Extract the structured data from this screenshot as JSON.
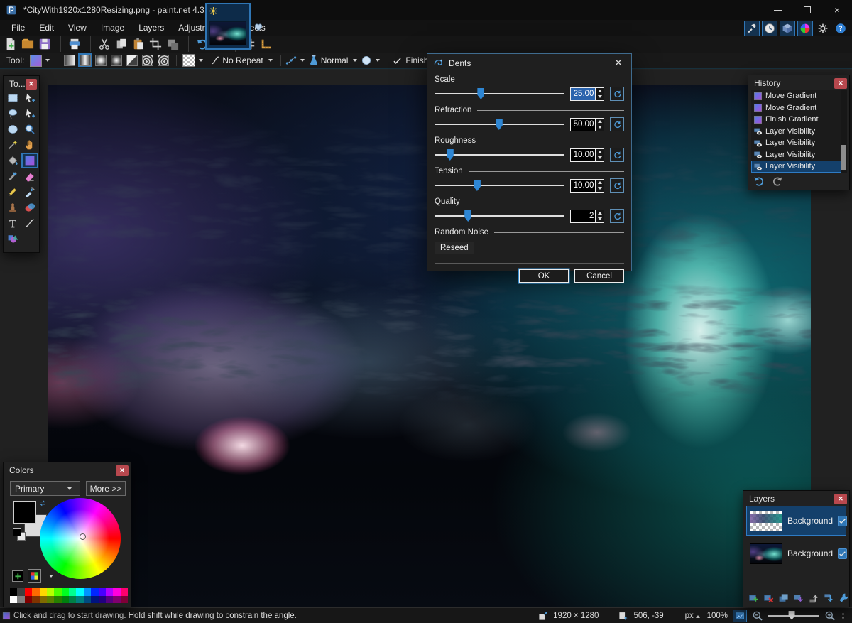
{
  "window": {
    "title": "*CityWith1920x1280Resizing.png - paint.net 4.3.12"
  },
  "menu": {
    "items": [
      "File",
      "Edit",
      "View",
      "Image",
      "Layers",
      "Adjustments",
      "Effects"
    ]
  },
  "toolbar": {
    "buttons": [
      {
        "icon": "new",
        "name": "new-image-button"
      },
      {
        "icon": "open",
        "name": "open-button"
      },
      {
        "icon": "save",
        "name": "save-button"
      },
      {
        "icon": "print",
        "name": "print-button",
        "gap": true
      },
      {
        "icon": "cut",
        "name": "cut-button",
        "gap": true
      },
      {
        "icon": "copy",
        "name": "copy-button"
      },
      {
        "icon": "paste",
        "name": "paste-button"
      },
      {
        "icon": "crop",
        "name": "crop-to-selection-button"
      },
      {
        "icon": "deselect",
        "name": "deselect-button"
      },
      {
        "icon": "undo",
        "name": "undo-button",
        "gap": true
      },
      {
        "icon": "redo",
        "name": "redo-button"
      },
      {
        "icon": "grid",
        "name": "grid-toggle",
        "gap": true
      },
      {
        "icon": "ruler",
        "name": "rulers-toggle"
      }
    ]
  },
  "utils": {
    "buttons": [
      {
        "icon": "hammer",
        "name": "tools-window-toggle",
        "active": true
      },
      {
        "icon": "clock",
        "name": "history-window-toggle",
        "active": true
      },
      {
        "icon": "cube",
        "name": "layers-window-toggle",
        "active": true
      },
      {
        "icon": "color-wheel",
        "name": "colors-window-toggle",
        "active": true
      },
      {
        "icon": "gear",
        "name": "settings-button"
      },
      {
        "icon": "help",
        "name": "help-button"
      }
    ]
  },
  "tool_options": {
    "tool_label": "Tool:",
    "repeat_mode": "No Repeat",
    "blend_mode": "Normal",
    "finish_label": "Finish",
    "gradient_types": [
      {
        "icon": "gt-linear",
        "name": "gradient-linear-button"
      },
      {
        "icon": "gt-reflected",
        "name": "gradient-linear-reflected-button",
        "selected": true
      },
      {
        "icon": "gt-radial",
        "name": "gradient-radial-button"
      },
      {
        "icon": "gt-box",
        "name": "gradient-box-button"
      },
      {
        "icon": "gt-diagonal",
        "name": "gradient-diagonal-button"
      },
      {
        "icon": "gt-spiral",
        "name": "gradient-spiral-cw-button"
      },
      {
        "icon": "gt-spiral2",
        "name": "gradient-spiral-ccw-button"
      }
    ]
  },
  "panels": {
    "tools": {
      "title": "To...",
      "items": [
        {
          "icon": "rect-select",
          "name": "tool-rectangle-select"
        },
        {
          "icon": "move-sel",
          "name": "tool-move-selected-pixels"
        },
        {
          "icon": "lasso",
          "name": "tool-lasso-select"
        },
        {
          "icon": "move-sel",
          "name": "tool-move-selection"
        },
        {
          "icon": "ellipse-select",
          "name": "tool-ellipse-select"
        },
        {
          "icon": "zoom-tool",
          "name": "tool-zoom"
        },
        {
          "icon": "magic-wand",
          "name": "tool-magic-wand"
        },
        {
          "icon": "pan-hand",
          "name": "tool-pan"
        },
        {
          "icon": "paint-bucket",
          "name": "tool-paint-bucket"
        },
        {
          "icon": "gradient-tool",
          "name": "tool-gradient",
          "selected": true
        },
        {
          "icon": "paintbrush",
          "name": "tool-paintbrush"
        },
        {
          "icon": "eraser",
          "name": "tool-eraser"
        },
        {
          "icon": "pencil",
          "name": "tool-pencil"
        },
        {
          "icon": "eyedropper",
          "name": "tool-color-picker"
        },
        {
          "icon": "clone-stamp",
          "name": "tool-clone-stamp"
        },
        {
          "icon": "recolor",
          "name": "tool-recolor"
        },
        {
          "icon": "text-tool",
          "name": "tool-text"
        },
        {
          "icon": "line-curve",
          "name": "tool-line-curve"
        },
        {
          "icon": "shapes",
          "name": "tool-shapes"
        }
      ]
    },
    "history": {
      "title": "History",
      "items": [
        {
          "icon": "gradient-swatch",
          "label": "Move Gradient"
        },
        {
          "icon": "gradient-swatch",
          "label": "Move Gradient"
        },
        {
          "icon": "gradient-swatch",
          "label": "Finish Gradient"
        },
        {
          "icon": "layer-vis",
          "label": "Layer Visibility"
        },
        {
          "icon": "layer-vis",
          "label": "Layer Visibility"
        },
        {
          "icon": "layer-vis",
          "label": "Layer Visibility"
        },
        {
          "icon": "layer-vis",
          "label": "Layer Visibility",
          "selected": true
        }
      ]
    },
    "colors": {
      "title": "Colors",
      "selector_value": "Primary",
      "more_label": "More >>",
      "palette1": [
        "#000000",
        "#404040",
        "#FF0000",
        "#FF6A00",
        "#FFD800",
        "#B6FF00",
        "#4CFF00",
        "#00FF21",
        "#00FF90",
        "#00FFFF",
        "#0094FF",
        "#0026FF",
        "#4800FF",
        "#B200FF",
        "#FF00DC",
        "#FF006E"
      ],
      "palette2": [
        "#FFFFFF",
        "#808080",
        "#7F0000",
        "#7F3300",
        "#7F6A00",
        "#5B7F00",
        "#267F00",
        "#007F0E",
        "#007F46",
        "#007F7F",
        "#004A7F",
        "#00137F",
        "#21007F",
        "#57007F",
        "#7F006E",
        "#7F0037"
      ]
    },
    "layers": {
      "title": "Layers",
      "items": [
        {
          "label": "Background",
          "thumb": "thumb-dents",
          "selected": true
        },
        {
          "label": "Background",
          "thumb": "mini-art"
        }
      ],
      "buttons": [
        {
          "icon": "add-layer",
          "name": "add-layer-button"
        },
        {
          "icon": "del-layer",
          "name": "delete-layer-button"
        },
        {
          "icon": "dup-layer",
          "name": "duplicate-layer-button"
        },
        {
          "icon": "merge-down",
          "name": "merge-down-button"
        },
        {
          "icon": "arrow-up",
          "name": "move-layer-up-button"
        },
        {
          "icon": "arrow-down",
          "name": "move-layer-down-button"
        },
        {
          "icon": "wrench",
          "name": "layer-properties-button"
        }
      ]
    }
  },
  "dialog": {
    "title": "Dents",
    "sliders": [
      {
        "label": "Scale",
        "value": "25.00",
        "pos": 36,
        "selected": true
      },
      {
        "label": "Refraction",
        "value": "50.00",
        "pos": 50
      },
      {
        "label": "Roughness",
        "value": "10.00",
        "pos": 12
      },
      {
        "label": "Tension",
        "value": "10.00",
        "pos": 33
      },
      {
        "label": "Quality",
        "value": "2",
        "pos": 26
      }
    ],
    "noise_label": "Random Noise",
    "reseed_label": "Reseed",
    "ok_label": "OK",
    "cancel_label": "Cancel"
  },
  "status": {
    "hint": "Click and drag to start drawing. Hold shift while drawing to constrain the angle.",
    "image_size": "1920 × 1280",
    "cursor_pos": "506, -39",
    "units": "px",
    "zoom": "100%"
  }
}
